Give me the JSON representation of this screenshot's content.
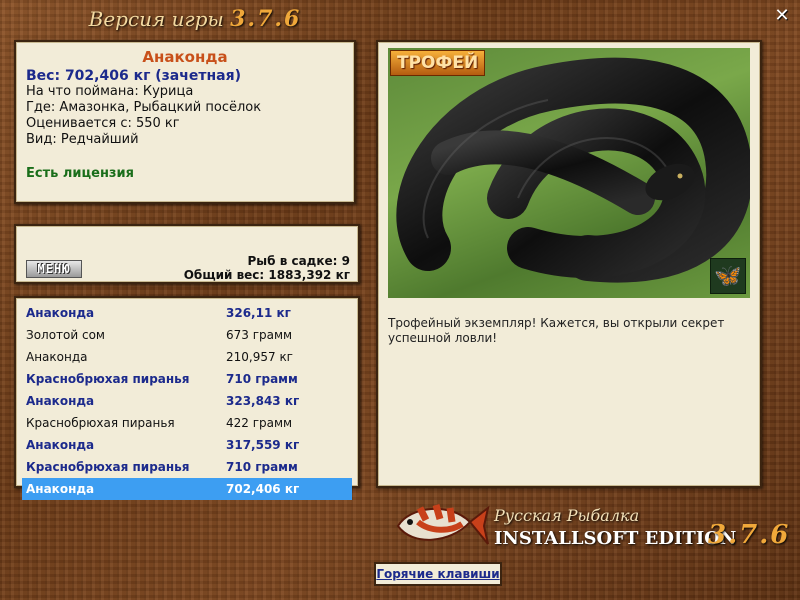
{
  "header": {
    "title_prefix": "Версия игры",
    "version": "3.7.6"
  },
  "catch": {
    "name": "Анаконда",
    "weight": "Вес: 702,406 кг (зачетная)",
    "bait": "На что поймана: Курица",
    "where": "Где: Амазонка, Рыбацкий посёлок",
    "rated_from": "Оценивается с: 550 кг",
    "kind": "Вид: Редчайший",
    "license": "Есть лицензия"
  },
  "keepnet": {
    "menu_label": "МЕНЮ",
    "count_text": "Рыб в садке: 9",
    "total_text": "Общий вес: 1883,392 кг"
  },
  "fish_list": [
    {
      "name": "Анаконда",
      "weight": "326,11 кг",
      "trophy": true,
      "selected": false
    },
    {
      "name": "Золотой сом",
      "weight": "673 грамм",
      "trophy": false,
      "selected": false
    },
    {
      "name": "Анаконда",
      "weight": "210,957 кг",
      "trophy": false,
      "selected": false
    },
    {
      "name": "Краснобрюхая пиранья",
      "weight": "710 грамм",
      "trophy": true,
      "selected": false
    },
    {
      "name": "Анаконда",
      "weight": "323,843 кг",
      "trophy": true,
      "selected": false
    },
    {
      "name": "Краснобрюхая пиранья",
      "weight": "422 грамм",
      "trophy": false,
      "selected": false
    },
    {
      "name": "Анаконда",
      "weight": "317,559 кг",
      "trophy": true,
      "selected": false
    },
    {
      "name": "Краснобрюхая пиранья",
      "weight": "710 грамм",
      "trophy": true,
      "selected": false
    },
    {
      "name": "Анаконда",
      "weight": "702,406 кг",
      "trophy": true,
      "selected": true
    }
  ],
  "photo": {
    "badge": "ТРОФЕЙ",
    "icon": "butterfly-icon",
    "description": "Трофейный экземпляр! Кажется, вы открыли секрет успешной ловли!"
  },
  "logo": {
    "line1": "Русская Рыбалка",
    "line2": "INSTALLSOFT EDITION",
    "version": "3.7.6"
  },
  "hotkeys_label": "Горячие клавиши",
  "colors": {
    "trophy": "#1c2a8c",
    "selected_bg": "#3d9ef2",
    "accent": "#f0a83a",
    "title_red": "#c8501a",
    "license_green": "#1a6e1a"
  }
}
